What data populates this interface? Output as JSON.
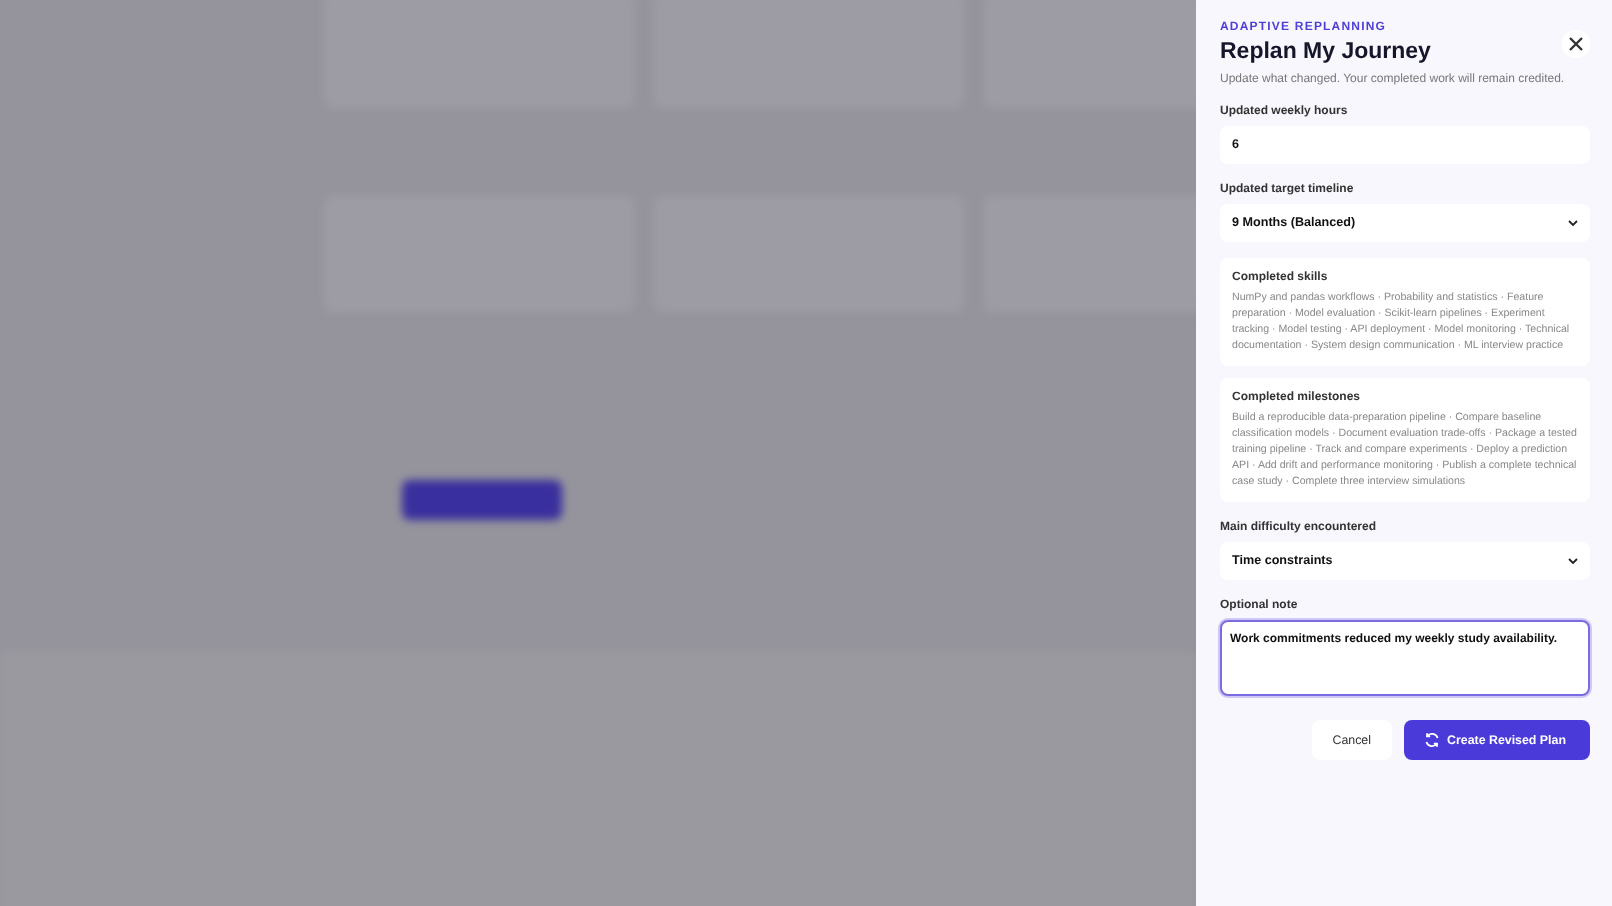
{
  "panel": {
    "eyebrow": "ADAPTIVE REPLANNING",
    "title": "Replan My Journey",
    "subtitle": "Update what changed. Your completed work will remain credited.",
    "form": [
      {
        "kind": "input",
        "label": "Updated weekly hours",
        "value": "6"
      },
      {
        "kind": "select",
        "label": "Updated target timeline",
        "value": "9 Months (Balanced)"
      },
      {
        "kind": "summary",
        "label": "Completed skills",
        "value": "NumPy and pandas workflows · Probability and statistics · Feature preparation · Model evaluation · Scikit-learn pipelines · Experiment tracking · Model testing · API deployment · Model monitoring · Technical documentation · System design communication · ML interview practice"
      },
      {
        "kind": "summary",
        "label": "Completed milestones",
        "value": "Build a reproducible data-preparation pipeline · Compare baseline classification models · Document evaluation trade-offs · Package a tested training pipeline · Track and compare experiments · Deploy a prediction API · Add drift and performance monitoring · Publish a complete technical case study · Complete three interview simulations"
      },
      {
        "kind": "select",
        "label": "Main difficulty encountered",
        "value": "Time constraints"
      },
      {
        "kind": "textarea",
        "label": "Optional note",
        "value": "Work commitments reduced my weekly study availability.",
        "focused": true
      }
    ],
    "buttons": [
      {
        "kind": "secondary",
        "label": "Cancel"
      },
      {
        "kind": "primary",
        "label": "Create Revised Plan"
      }
    ]
  }
}
